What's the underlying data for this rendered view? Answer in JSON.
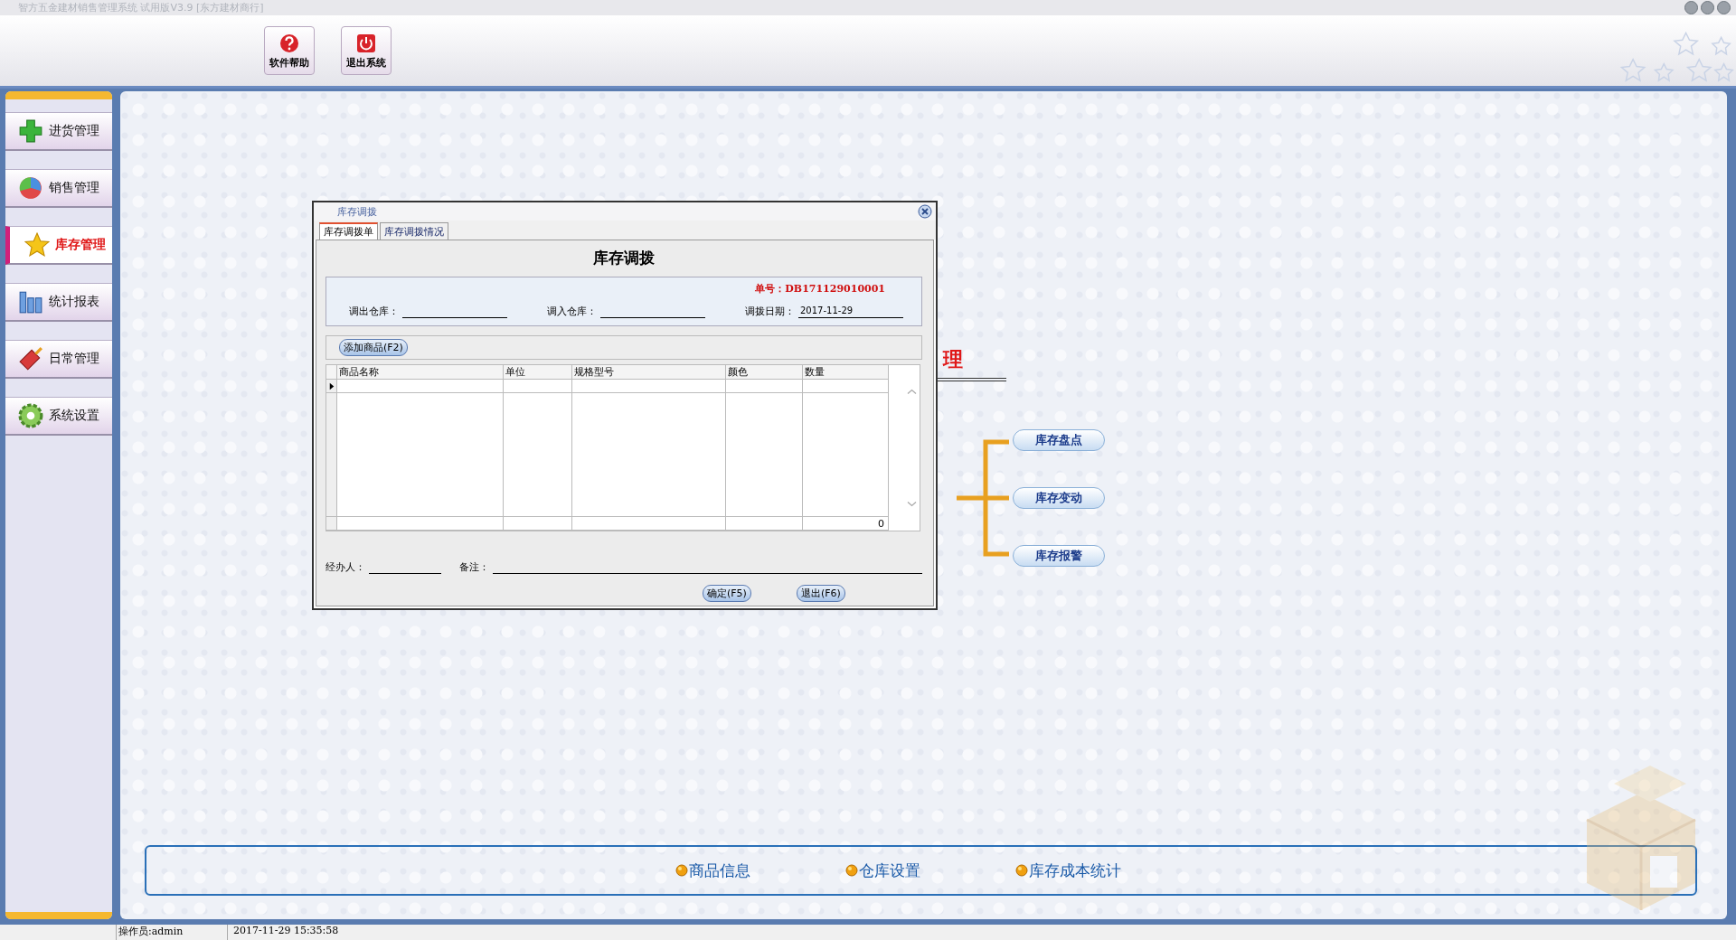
{
  "window": {
    "title": "智方五金建材销售管理系统 试用版V3.9 [东方建材商行]"
  },
  "toolbar": {
    "buttons": [
      {
        "label": "软件帮助",
        "kind": "help"
      },
      {
        "label": "退出系统",
        "kind": "exit"
      }
    ]
  },
  "sidebar": {
    "items": [
      {
        "label": "进货管理",
        "kind": "plus",
        "selected": false
      },
      {
        "label": "销售管理",
        "kind": "pie",
        "selected": false
      },
      {
        "label": "库存管理",
        "kind": "star",
        "selected": true
      },
      {
        "label": "统计报表",
        "kind": "bars",
        "selected": false
      },
      {
        "label": "日常管理",
        "kind": "brush",
        "selected": false
      },
      {
        "label": "系统设置",
        "kind": "gear",
        "selected": false
      }
    ]
  },
  "page": {
    "heading_fragment": "理",
    "flow_buttons": [
      {
        "label": "库存盘点"
      },
      {
        "label": "库存变动"
      },
      {
        "label": "库存报警"
      }
    ],
    "links": [
      {
        "label": "商品信息"
      },
      {
        "label": "仓库设置"
      },
      {
        "label": "库存成本统计"
      }
    ]
  },
  "dialog": {
    "title": "库存调拨",
    "tabs": [
      {
        "label": "库存调拨单",
        "selected": true
      },
      {
        "label": "库存调拨情况",
        "selected": false
      }
    ],
    "heading": "库存调拨",
    "order_no": "单号：DB171129010001",
    "fields": [
      {
        "label": "调出仓库："
      },
      {
        "label": "调入仓库："
      },
      {
        "label": "调拨日期：",
        "value": "2017-11-29"
      }
    ],
    "add_button": "添加商品(F2)",
    "table": {
      "columns": [
        "商品名称",
        "单位",
        "规格型号",
        "颜色",
        "数量"
      ],
      "footer_total": "0"
    },
    "footer_fields": [
      {
        "label": "经办人：",
        "kind": "short"
      },
      {
        "label": "备注：",
        "kind": "long"
      }
    ],
    "buttons": [
      "确定(F5)",
      "退出(F6)"
    ]
  },
  "status_bar": {
    "operator": "操作员:admin",
    "datetime": "2017-11-29 15:35:58"
  }
}
